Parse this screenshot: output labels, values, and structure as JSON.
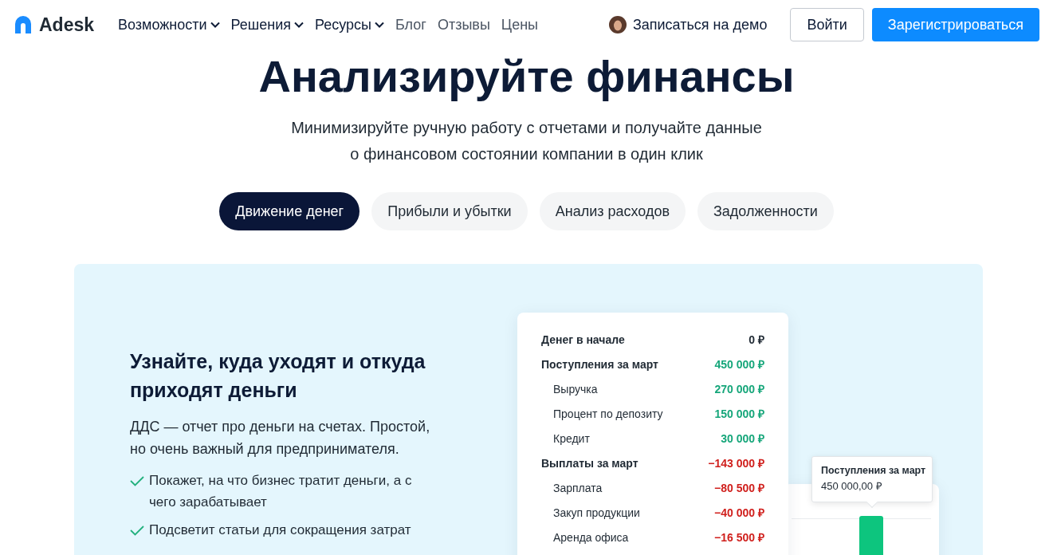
{
  "brand": "Adesk",
  "nav": [
    {
      "label": "Возможности",
      "dropdown": true
    },
    {
      "label": "Решения",
      "dropdown": true
    },
    {
      "label": "Ресурсы",
      "dropdown": true
    },
    {
      "label": "Блог",
      "dropdown": false
    },
    {
      "label": "Отзывы",
      "dropdown": false
    },
    {
      "label": "Цены",
      "dropdown": false
    }
  ],
  "demo_link": "Записаться на демо",
  "login_button": "Войти",
  "signup_button": "Зарегистрироваться",
  "hero": {
    "title": "Анализируйте финансы",
    "subtitle": [
      "Минимизируйте ручную работу с отчетами и получайте данные",
      "о финансовом состоянии компании в один клик"
    ]
  },
  "tabs": [
    {
      "label": "Движение денег",
      "selected": true
    },
    {
      "label": "Прибыли и убытки",
      "selected": false
    },
    {
      "label": "Анализ расходов",
      "selected": false
    },
    {
      "label": "Задолженности",
      "selected": false
    }
  ],
  "feature": {
    "heading": "Узнайте, куда уходят и откуда приходят деньги",
    "description": "ДДС — отчет про деньги на счетах. Простой, но очень важный для предпринимателя.",
    "points": [
      "Покажет, на что бизнес тратит деньги, а с чего зарабатывает",
      "Подсветит статьи для сокращения затрат"
    ]
  },
  "report": [
    {
      "label": "Денег в начале",
      "value": "0 ₽",
      "kind": "total",
      "color": "#1f2933"
    },
    {
      "label": "Поступления за март",
      "value": "450 000 ₽",
      "kind": "total",
      "color": "#16a67a"
    },
    {
      "label": "Выручка",
      "value": "270 000 ₽",
      "kind": "item",
      "color": "#16a67a"
    },
    {
      "label": "Процент по депозиту",
      "value": "150 000 ₽",
      "kind": "item",
      "color": "#16a67a"
    },
    {
      "label": "Кредит",
      "value": "30 000 ₽",
      "kind": "item",
      "color": "#16a67a"
    },
    {
      "label": "Выплаты за март",
      "value": "−143 000 ₽",
      "kind": "total",
      "color": "#d0201d"
    },
    {
      "label": "Зарплата",
      "value": "−80 500 ₽",
      "kind": "item",
      "color": "#d0201d"
    },
    {
      "label": "Закуп продукции",
      "value": "−40 000 ₽",
      "kind": "item",
      "color": "#d0201d"
    },
    {
      "label": "Аренда офиса",
      "value": "−16 500 ₽",
      "kind": "item",
      "color": "#d0201d"
    }
  ],
  "tooltip": {
    "title": "Поступления за март",
    "value": "450 000,00 ₽"
  }
}
